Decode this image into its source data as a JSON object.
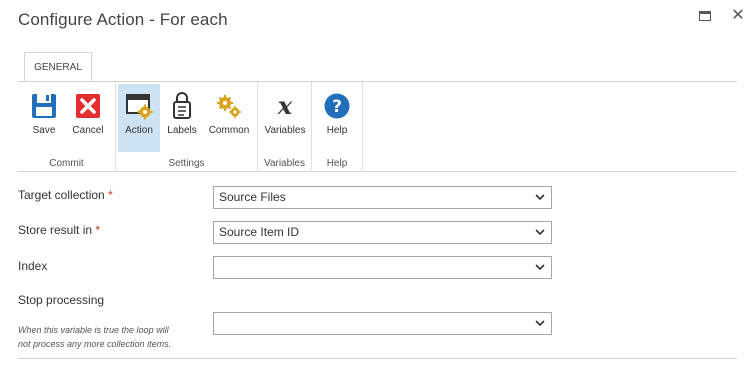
{
  "dialog": {
    "title": "Configure Action - For each"
  },
  "tabs": [
    {
      "label": "GENERAL"
    }
  ],
  "ribbon": {
    "groups": [
      {
        "label": "Commit",
        "buttons": [
          {
            "label": "Save",
            "icon": "save-icon"
          },
          {
            "label": "Cancel",
            "icon": "cancel-icon"
          }
        ]
      },
      {
        "label": "Settings",
        "buttons": [
          {
            "label": "Action",
            "icon": "action-icon",
            "selected": true
          },
          {
            "label": "Labels",
            "icon": "labels-icon"
          },
          {
            "label": "Common",
            "icon": "common-icon"
          }
        ]
      },
      {
        "label": "Variables",
        "buttons": [
          {
            "label": "Variables",
            "icon": "variables-icon"
          }
        ]
      },
      {
        "label": "Help",
        "buttons": [
          {
            "label": "Help",
            "icon": "help-icon"
          }
        ]
      }
    ]
  },
  "form": {
    "fields": [
      {
        "label": "Target collection",
        "required": "*",
        "value": "Source Files"
      },
      {
        "label": "Store result in",
        "required": "*",
        "value": "Source Item ID"
      },
      {
        "label": "Index",
        "required": "",
        "value": ""
      },
      {
        "label": "Stop processing",
        "required": "",
        "value": "",
        "hint_line1": "When this variable is true the loop will",
        "hint_line2": "not process any more collection items."
      }
    ]
  },
  "colors": {
    "accent_blue": "#1f6fba",
    "selected_bg": "#cde3f4",
    "cancel_red": "#e3302f",
    "gear_gold": "#d9a31b",
    "required_red": "#c0392b"
  }
}
